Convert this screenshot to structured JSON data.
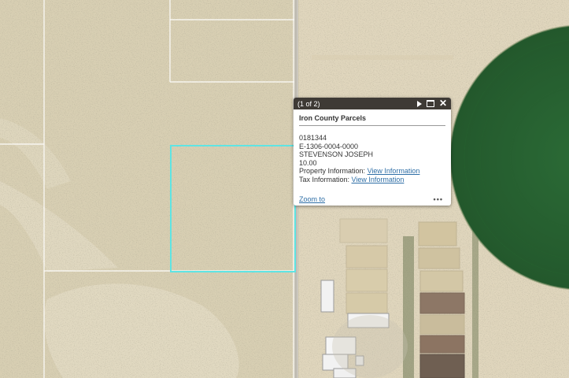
{
  "popup": {
    "pager": "(1 of 2)",
    "title": "Iron County Parcels",
    "parcel_id": "0181344",
    "account": "E-1306-0004-0000",
    "owner": "STEVENSON JOSEPH",
    "acreage": "10.00",
    "property_label": "Property Information:",
    "property_link": "View Information",
    "tax_label": "Tax Information:",
    "tax_link": "View Information",
    "zoom_label": "Zoom to",
    "more_label": "•••"
  },
  "colors": {
    "desert": "#d9cfb2",
    "field_green": "#2f6b35",
    "parcel_highlight": "#59dfe0",
    "popup_header": "#3e3a35",
    "link": "#2e6ea6"
  }
}
